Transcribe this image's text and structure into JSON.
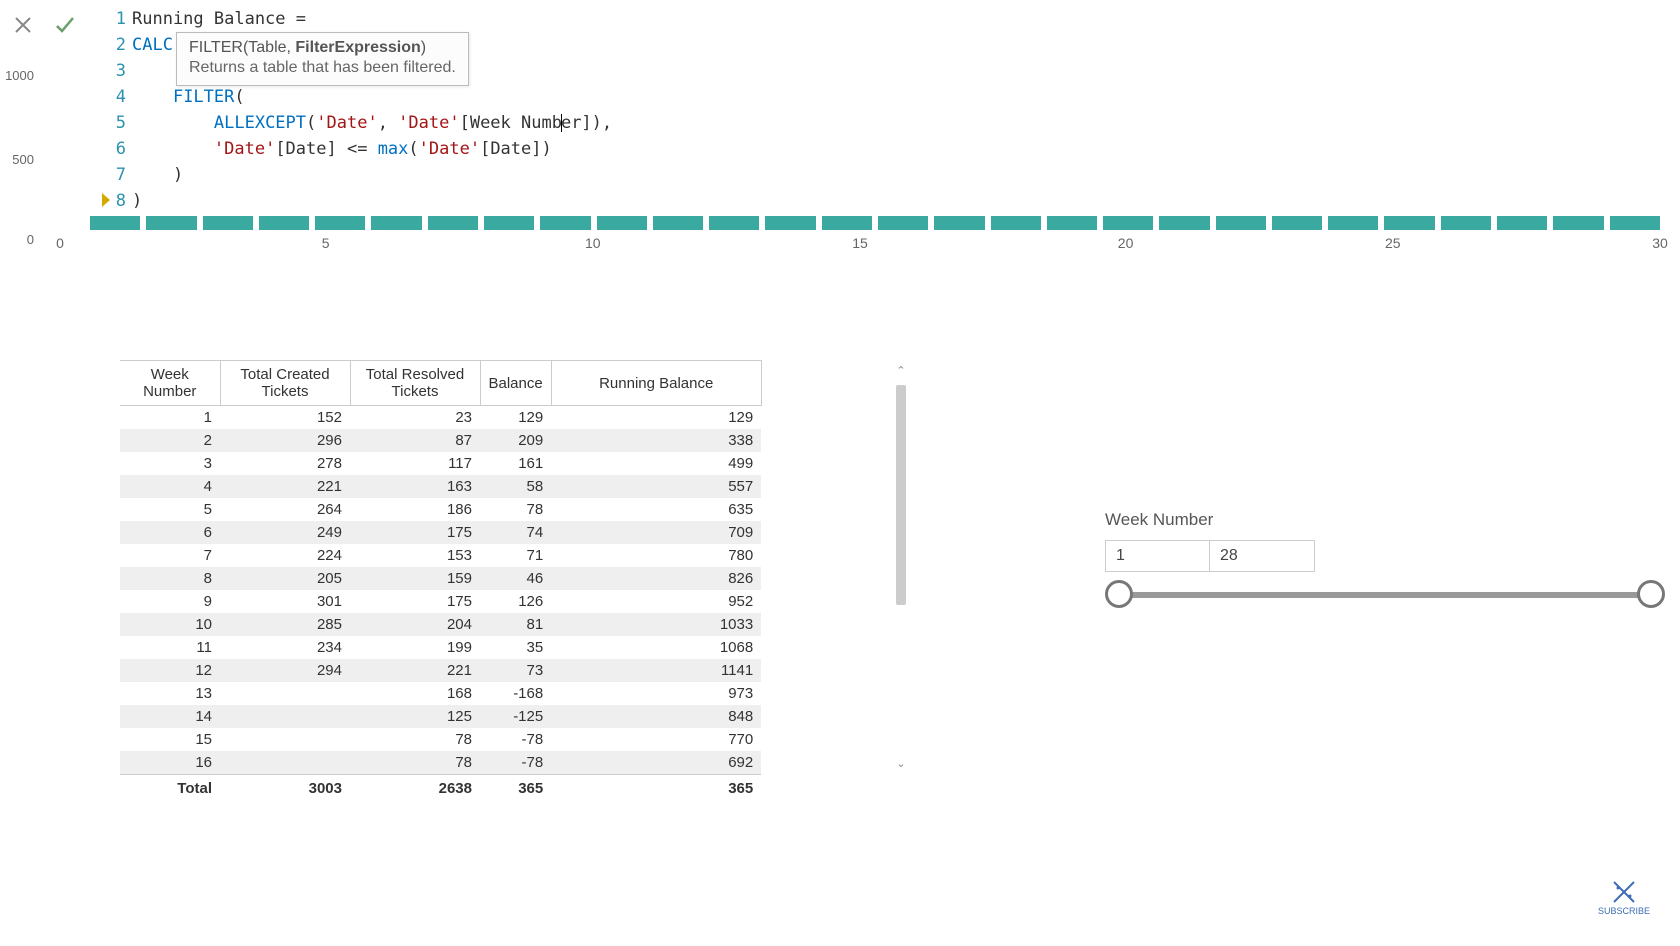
{
  "formula": {
    "lines": [
      {
        "num": "1",
        "raw": "Running Balance ="
      },
      {
        "num": "2",
        "raw": "CALC"
      },
      {
        "num": "3",
        "raw": "    ["
      },
      {
        "num": "4",
        "raw": "    FILTER("
      },
      {
        "num": "5",
        "raw": "        ALLEXCEPT('Date', 'Date'[Week Number]),"
      },
      {
        "num": "6",
        "raw": "        'Date'[Date] <= max('Date'[Date])"
      },
      {
        "num": "7",
        "raw": "    )"
      },
      {
        "num": "8",
        "raw": ")"
      }
    ],
    "line1": "Running Balance =",
    "line2_func": "CALC",
    "line4_func": "FILTER",
    "line4_paren": "(",
    "line5_func": "ALLEXCEPT",
    "line5_rest_a": "(",
    "line5_table1": "'Date'",
    "line5_comma": ", ",
    "line5_table2": "'Date'",
    "line5_col": "[Week Number]",
    "line5_end": "),",
    "line6_table1": "'Date'",
    "line6_col1": "[Date]",
    "line6_op": " <= ",
    "line6_max": "max",
    "line6_paren": "(",
    "line6_table2": "'Date'",
    "line6_col2": "[Date]",
    "line6_end": ")",
    "line7": "    )",
    "line8": ")"
  },
  "intellisense": {
    "func": "FILTER",
    "sig_open": "(Table, ",
    "sig_bold": "FilterExpression",
    "sig_close": ")",
    "desc": "Returns a table that has been filtered."
  },
  "chart_data": {
    "type": "bar",
    "y_ticks": [
      "1000",
      "500",
      "0"
    ],
    "x_ticks": [
      {
        "pos": 0,
        "label": "0"
      },
      {
        "pos": 16.6,
        "label": "5"
      },
      {
        "pos": 33.3,
        "label": "10"
      },
      {
        "pos": 50,
        "label": "15"
      },
      {
        "pos": 66.6,
        "label": "20"
      },
      {
        "pos": 83.3,
        "label": "25"
      },
      {
        "pos": 100,
        "label": "30"
      }
    ],
    "bar_count": 28,
    "note": "bars mostly occluded by formula editor; only tops visible at identical low height"
  },
  "table": {
    "headers": [
      "Week Number",
      "Total Created Tickets",
      "Total Resolved Tickets",
      "Balance",
      "Running Balance"
    ],
    "rows": [
      [
        "1",
        "152",
        "23",
        "129",
        "129"
      ],
      [
        "2",
        "296",
        "87",
        "209",
        "338"
      ],
      [
        "3",
        "278",
        "117",
        "161",
        "499"
      ],
      [
        "4",
        "221",
        "163",
        "58",
        "557"
      ],
      [
        "5",
        "264",
        "186",
        "78",
        "635"
      ],
      [
        "6",
        "249",
        "175",
        "74",
        "709"
      ],
      [
        "7",
        "224",
        "153",
        "71",
        "780"
      ],
      [
        "8",
        "205",
        "159",
        "46",
        "826"
      ],
      [
        "9",
        "301",
        "175",
        "126",
        "952"
      ],
      [
        "10",
        "285",
        "204",
        "81",
        "1033"
      ],
      [
        "11",
        "234",
        "199",
        "35",
        "1068"
      ],
      [
        "12",
        "294",
        "221",
        "73",
        "1141"
      ],
      [
        "13",
        "",
        "168",
        "-168",
        "973"
      ],
      [
        "14",
        "",
        "125",
        "-125",
        "848"
      ],
      [
        "15",
        "",
        "78",
        "-78",
        "770"
      ],
      [
        "16",
        "",
        "78",
        "-78",
        "692"
      ]
    ],
    "total_row": [
      "Total",
      "3003",
      "2638",
      "365",
      "365"
    ]
  },
  "slicer": {
    "title": "Week Number",
    "min": "1",
    "max": "28"
  },
  "logo": {
    "text": "SUBSCRIBE"
  }
}
